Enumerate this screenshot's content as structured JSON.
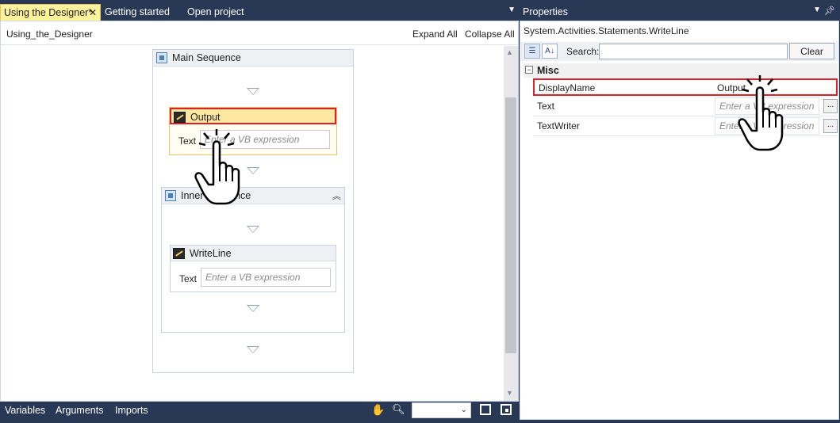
{
  "document_tabs": [
    {
      "label": "Using the Designer*",
      "active": true,
      "close": "✕"
    },
    {
      "label": "Getting started",
      "active": false
    },
    {
      "label": "Open project",
      "active": false
    }
  ],
  "designer": {
    "breadcrumb": "Using_the_Designer",
    "expand_all": "Expand All",
    "collapse_all": "Collapse All",
    "main_sequence": {
      "title": "Main Sequence",
      "output_activity": {
        "title": "Output",
        "text_label": "Text",
        "text_placeholder": "Enter a VB expression"
      },
      "inner_sequence": {
        "title": "Inner Sequence",
        "writeline_activity": {
          "title": "WriteLine",
          "text_label": "Text",
          "text_placeholder": "Enter a VB expression"
        }
      }
    }
  },
  "bottom_tabs": {
    "variables": "Variables",
    "arguments": "Arguments",
    "imports": "Imports"
  },
  "properties": {
    "title": "Properties",
    "type_name": "System.Activities.Statements.WriteLine",
    "search_label": "Search:",
    "search_value": "",
    "clear_label": "Clear",
    "category": "Misc",
    "category_toggle": "−",
    "rows": [
      {
        "name": "DisplayName",
        "value": "Output"
      },
      {
        "name": "Text",
        "placeholder": "Enter a VB expression",
        "ellipsis": "..."
      },
      {
        "name": "TextWriter",
        "placeholder": "Enter a VB expression",
        "ellipsis": "..."
      }
    ]
  },
  "colors": {
    "accent_dark": "#293955",
    "selected_tab": "#fff29d",
    "highlight_border": "#e01f26"
  }
}
